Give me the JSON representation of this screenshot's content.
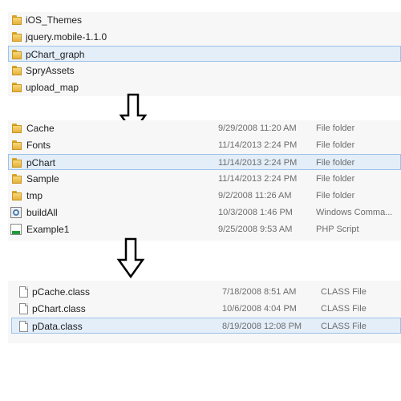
{
  "panel1": {
    "folders": [
      {
        "name": "iOS_Themes",
        "icon": "folder-icon"
      },
      {
        "name": "jquery.mobile-1.1.0",
        "icon": "folder-icon"
      },
      {
        "name": "pChart_graph",
        "icon": "folder-icon",
        "selected": true
      },
      {
        "name": "SpryAssets",
        "icon": "folder-icon"
      },
      {
        "name": "upload_map",
        "icon": "folder-icon"
      }
    ]
  },
  "panel2": {
    "rows": [
      {
        "name": "Cache",
        "date": "9/29/2008 11:20 AM",
        "type": "File folder",
        "icon": "folder-icon"
      },
      {
        "name": "Fonts",
        "date": "11/14/2013 2:24 PM",
        "type": "File folder",
        "icon": "folder-icon"
      },
      {
        "name": "pChart",
        "date": "11/14/2013 2:24 PM",
        "type": "File folder",
        "icon": "folder-icon",
        "selected": true
      },
      {
        "name": "Sample",
        "date": "11/14/2013 2:24 PM",
        "type": "File folder",
        "icon": "folder-icon"
      },
      {
        "name": "tmp",
        "date": "9/2/2008 11:26 AM",
        "type": "File folder",
        "icon": "folder-icon"
      },
      {
        "name": "buildAll",
        "date": "10/3/2008 1:46 PM",
        "type": "Windows Comma...",
        "icon": "cmd-icon"
      },
      {
        "name": "Example1",
        "date": "9/25/2008 9:53 AM",
        "type": "PHP Script",
        "icon": "php-file-icon"
      }
    ]
  },
  "panel3": {
    "rows": [
      {
        "name": "pCache.class",
        "date": "7/18/2008 8:51 AM",
        "type": "CLASS File",
        "icon": "document-icon"
      },
      {
        "name": "pChart.class",
        "date": "10/6/2008 4:04 PM",
        "type": "CLASS File",
        "icon": "document-icon"
      },
      {
        "name": "pData.class",
        "date": "8/19/2008 12:08 PM",
        "type": "CLASS File",
        "icon": "document-icon",
        "selected": true
      }
    ]
  },
  "arrows": {
    "icon": "down-arrow-icon"
  }
}
